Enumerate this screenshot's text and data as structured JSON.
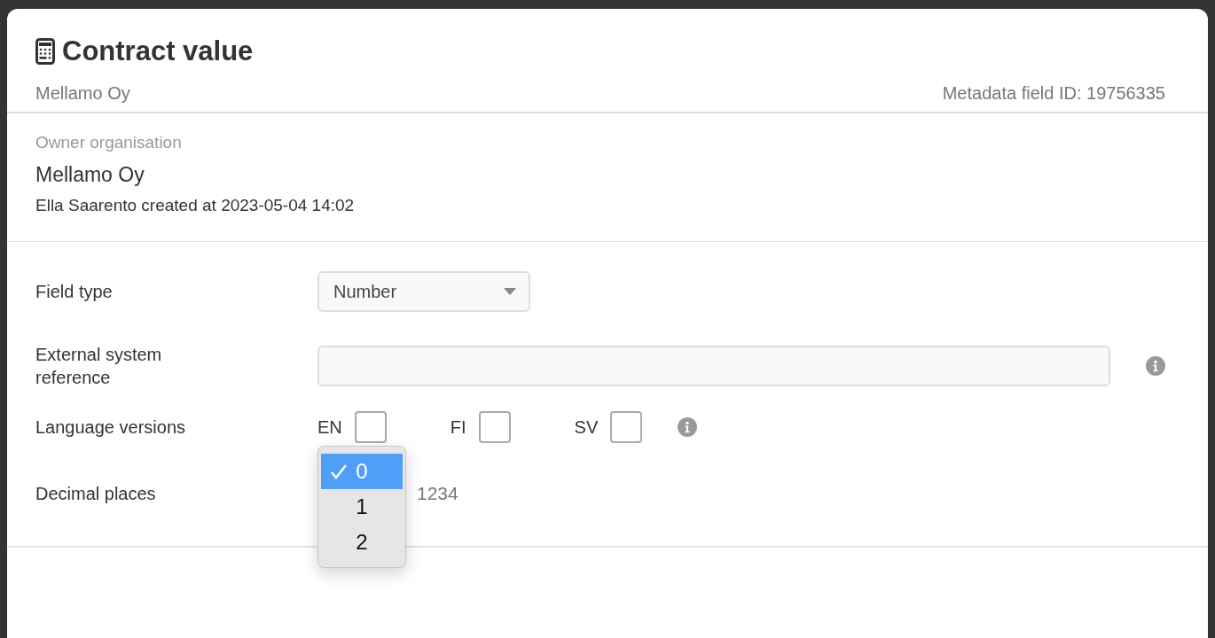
{
  "header": {
    "title": "Contract value",
    "organisation": "Mellamo Oy",
    "field_id": "Metadata field ID: 19756335"
  },
  "owner": {
    "label": "Owner organisation",
    "name": "Mellamo Oy",
    "created": "Ella Saarento created at 2023-05-04 14:02"
  },
  "form": {
    "field_type": {
      "label": "Field type",
      "value": "Number"
    },
    "external_reference": {
      "label": "External system reference"
    },
    "language_versions": {
      "label": "Language versions",
      "languages": [
        {
          "code": "EN",
          "checked": false
        },
        {
          "code": "FI",
          "checked": false
        },
        {
          "code": "SV",
          "checked": false
        }
      ]
    },
    "decimal_places": {
      "label": "Decimal places",
      "expanded": true,
      "options": [
        {
          "label": "0",
          "selected": true
        },
        {
          "label": "1",
          "selected": false
        },
        {
          "label": "2",
          "selected": false
        }
      ],
      "preview": "1234"
    }
  }
}
